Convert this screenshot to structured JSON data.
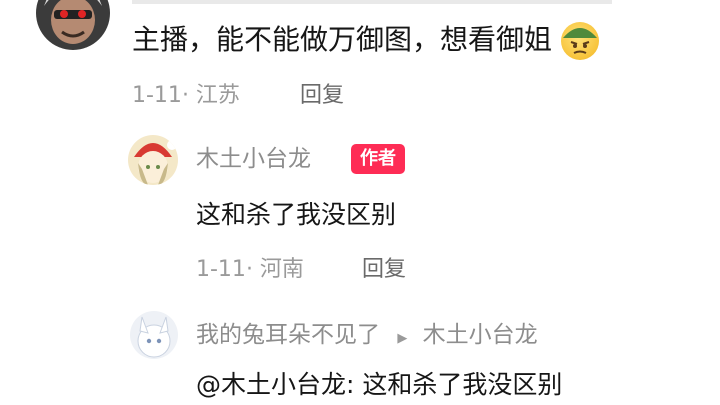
{
  "comment1": {
    "text": "主播，能不能做万御图，想看御姐",
    "emoji_icon": "annoyed-face-emoji",
    "date": "1-11",
    "location": "· 江苏",
    "reply_label": "回复"
  },
  "reply1": {
    "author": "木土小台龙",
    "badge": "作者",
    "text": "这和杀了我没区别",
    "date": "1-11",
    "location": "· 河南",
    "reply_label": "回复"
  },
  "reply2": {
    "author": "我的兔耳朵不见了",
    "reply_to": "木土小台龙",
    "text": "@木土小台龙: 这和杀了我没区别"
  },
  "colors": {
    "badge_bg": "#fe2c55",
    "meta_gray": "#9a9a9a",
    "text_dark": "#161616"
  }
}
